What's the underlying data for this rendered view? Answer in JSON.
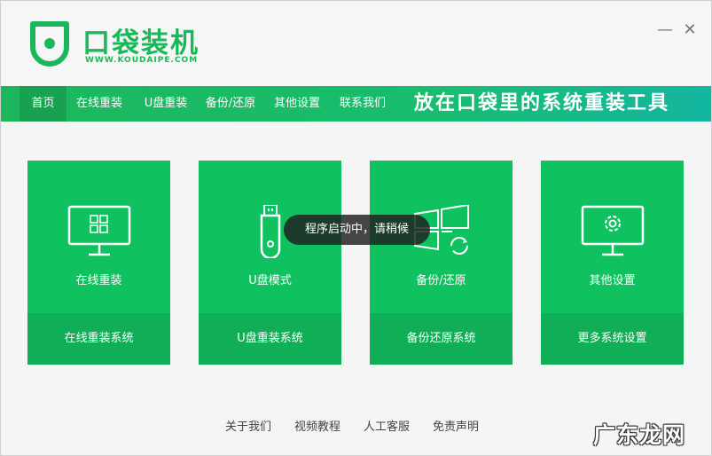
{
  "app": {
    "brand": "口袋装机",
    "url": "WWW.KOUDAIPE.COM",
    "slogan": "放在口袋里的系统重装工具",
    "accent": "#10c25f",
    "accent_dark": "#0fae57",
    "nav_active": "#17a150"
  },
  "window_controls": {
    "minimize": "—",
    "close": "✕"
  },
  "nav": {
    "items": [
      {
        "label": "首页"
      },
      {
        "label": "在线重装"
      },
      {
        "label": "U盘重装"
      },
      {
        "label": "备份/还原"
      },
      {
        "label": "其他设置"
      },
      {
        "label": "联系我们"
      }
    ]
  },
  "cards": [
    {
      "title": "在线重装",
      "action": "在线重装系统",
      "icon": "monitor-windows-icon"
    },
    {
      "title": "U盘模式",
      "action": "U盘重装系统",
      "icon": "usb-drive-icon"
    },
    {
      "title": "备份/还原",
      "action": "备份还原系统",
      "icon": "windows-refresh-icon"
    },
    {
      "title": "其他设置",
      "action": "更多系统设置",
      "icon": "monitor-gear-icon"
    }
  ],
  "toast": {
    "text": "程序启动中，请稍候"
  },
  "footer": {
    "links": [
      {
        "label": "关于我们"
      },
      {
        "label": "视频教程"
      },
      {
        "label": "人工客服"
      },
      {
        "label": "免责声明"
      }
    ]
  },
  "watermark": {
    "text": "广东龙网"
  }
}
